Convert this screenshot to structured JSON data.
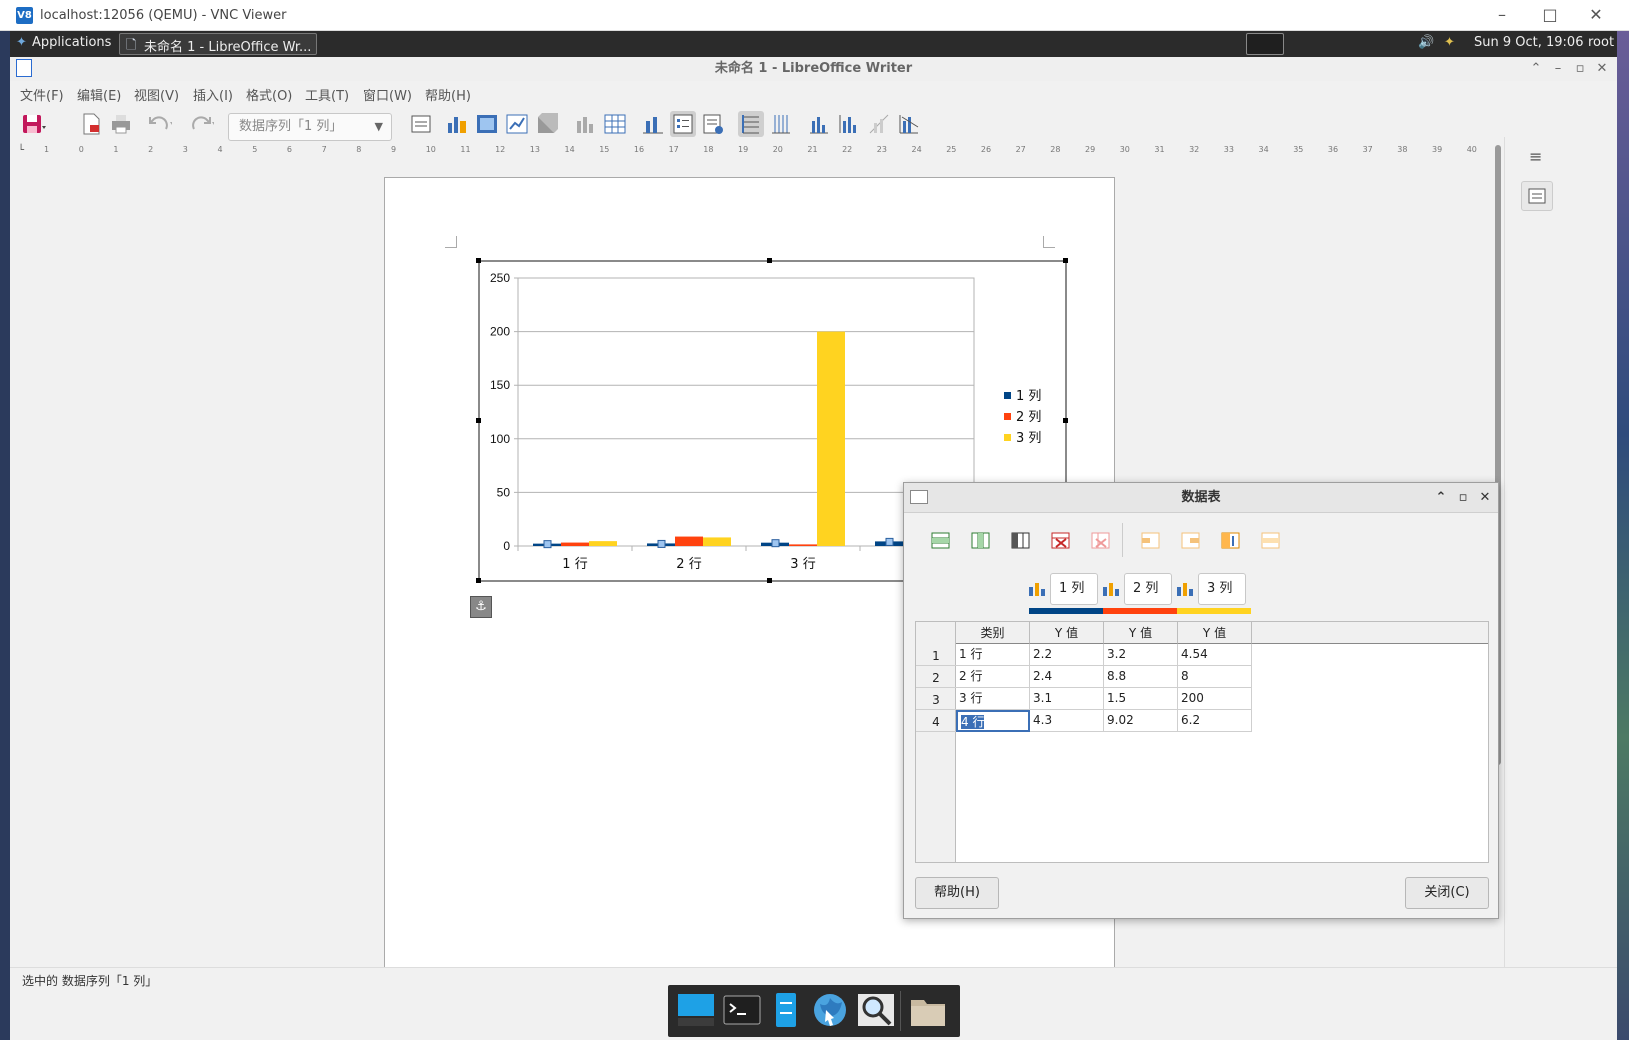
{
  "vnc": {
    "title": "localhost:12056 (QEMU) - VNC Viewer",
    "icon": "V8"
  },
  "panel": {
    "applications": "Applications",
    "task_label": "未命名 1 - LibreOffice Wr...",
    "clock": "Sun  9 Oct, 19:06",
    "user": "root"
  },
  "writer": {
    "title": "未命名 1 - LibreOffice Writer",
    "menu": [
      "文件(F)",
      "编辑(E)",
      "视图(V)",
      "插入(I)",
      "格式(O)",
      "工具(T)",
      "窗口(W)",
      "帮助(H)"
    ],
    "series_select": "数据序列「1 列」",
    "ruler_marks": [
      "1",
      "0",
      "1",
      "2",
      "3",
      "4",
      "5",
      "6",
      "7",
      "8",
      "9",
      "10",
      "11",
      "12",
      "13",
      "14",
      "15",
      "16",
      "17",
      "18",
      "19",
      "20",
      "21",
      "22",
      "23",
      "24",
      "25",
      "26",
      "27",
      "28",
      "29",
      "30",
      "31",
      "32",
      "33",
      "34",
      "35",
      "36",
      "37",
      "38",
      "39",
      "40"
    ],
    "status": "选中的 数据序列「1 列」"
  },
  "chart_data": {
    "type": "bar",
    "categories": [
      "1 行",
      "2 行",
      "3 行",
      "4 行"
    ],
    "series": [
      {
        "name": "1 列",
        "values": [
          2.2,
          2.4,
          3.1,
          4.3
        ],
        "color": "#004586"
      },
      {
        "name": "2 列",
        "values": [
          3.2,
          8.8,
          1.5,
          9.02
        ],
        "color": "#ff420e"
      },
      {
        "name": "3 列",
        "values": [
          4.54,
          8,
          200,
          6.2
        ],
        "color": "#ffd320"
      }
    ],
    "ylim": [
      0,
      250
    ],
    "yticks": [
      "250",
      "200",
      "150",
      "100",
      "50",
      "0"
    ],
    "grid": true,
    "legend": "right"
  },
  "dialog": {
    "title": "数据表",
    "series_names": [
      "1 列",
      "2 列",
      "3 列"
    ],
    "headers": [
      "类别",
      "Y 值",
      "Y 值",
      "Y 值"
    ],
    "rows": [
      {
        "num": "1",
        "cells": [
          "1 行",
          "2.2",
          "3.2",
          "4.54"
        ]
      },
      {
        "num": "2",
        "cells": [
          "2 行",
          "2.4",
          "8.8",
          "8"
        ]
      },
      {
        "num": "3",
        "cells": [
          "3 行",
          "3.1",
          "1.5",
          "200"
        ]
      },
      {
        "num": "4",
        "cells": [
          "4 行",
          "4.3",
          "9.02",
          "6.2"
        ]
      }
    ],
    "help_label": "帮助(H)",
    "close_label": "关闭(C)"
  }
}
